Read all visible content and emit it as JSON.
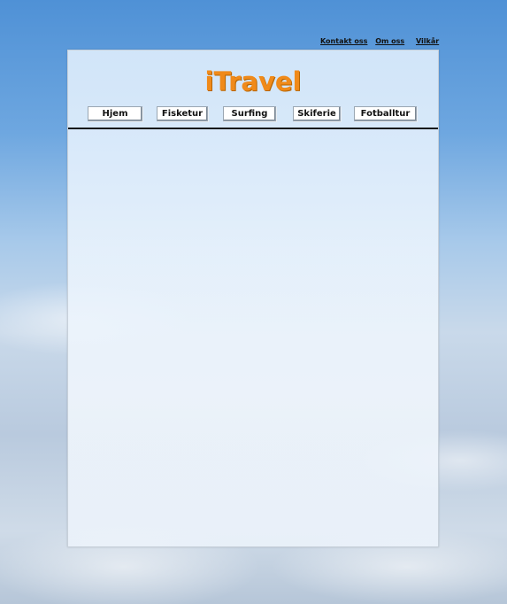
{
  "top_links": [
    "Kontakt oss",
    "Om oss",
    "Vilkår"
  ],
  "logo": "iTravel",
  "nav": [
    "Hjem",
    "Fisketur",
    "Surfing",
    "Skiferie",
    "Fotballtur"
  ]
}
